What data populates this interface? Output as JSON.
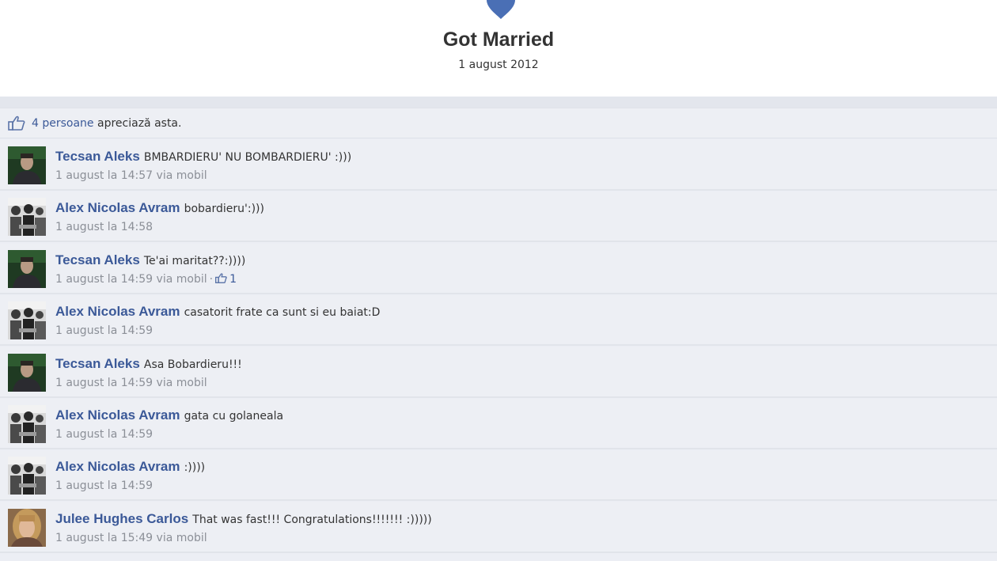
{
  "event": {
    "title": "Got Married",
    "date": "1 august 2012"
  },
  "likes": {
    "count_text": "4 persoane",
    "suffix": " apreciază asta."
  },
  "comments": [
    {
      "author": "Tecsan Aleks",
      "text": "BMBARDIERU' NU BOMBARDIERU' :)))",
      "time": "1 august la 14:57",
      "via": "via mobil",
      "avatar": "man-dark"
    },
    {
      "author": "Alex Nicolas Avram",
      "text": "bobardieru':)))",
      "time": "1 august la 14:58",
      "avatar": "group-bw"
    },
    {
      "author": "Tecsan Aleks",
      "text": "Te'ai maritat??:))))",
      "time": "1 august la 14:59",
      "via": "via mobil",
      "likes": "1",
      "avatar": "man-dark"
    },
    {
      "author": "Alex Nicolas Avram",
      "text": "casatorit frate ca sunt si eu baiat:D",
      "time": "1 august la 14:59",
      "avatar": "group-bw"
    },
    {
      "author": "Tecsan Aleks",
      "text": "Asa Bobardieru!!!",
      "time": "1 august la 14:59",
      "via": "via mobil",
      "avatar": "man-dark"
    },
    {
      "author": "Alex Nicolas Avram",
      "text": "gata cu golaneala",
      "time": "1 august la 14:59",
      "avatar": "group-bw"
    },
    {
      "author": "Alex Nicolas Avram",
      "text": ":))))",
      "time": "1 august la 14:59",
      "avatar": "group-bw"
    },
    {
      "author": "Julee Hughes Carlos",
      "text": "That was fast!!! Congratulations!!!!!!! :)))))",
      "time": "1 august la 15:49",
      "via": "via mobil",
      "avatar": "woman-blonde"
    }
  ],
  "colors": {
    "link": "#3b5998",
    "heart": "#4a6fb5",
    "background": "#edeff4",
    "meta": "#8b8f97"
  }
}
